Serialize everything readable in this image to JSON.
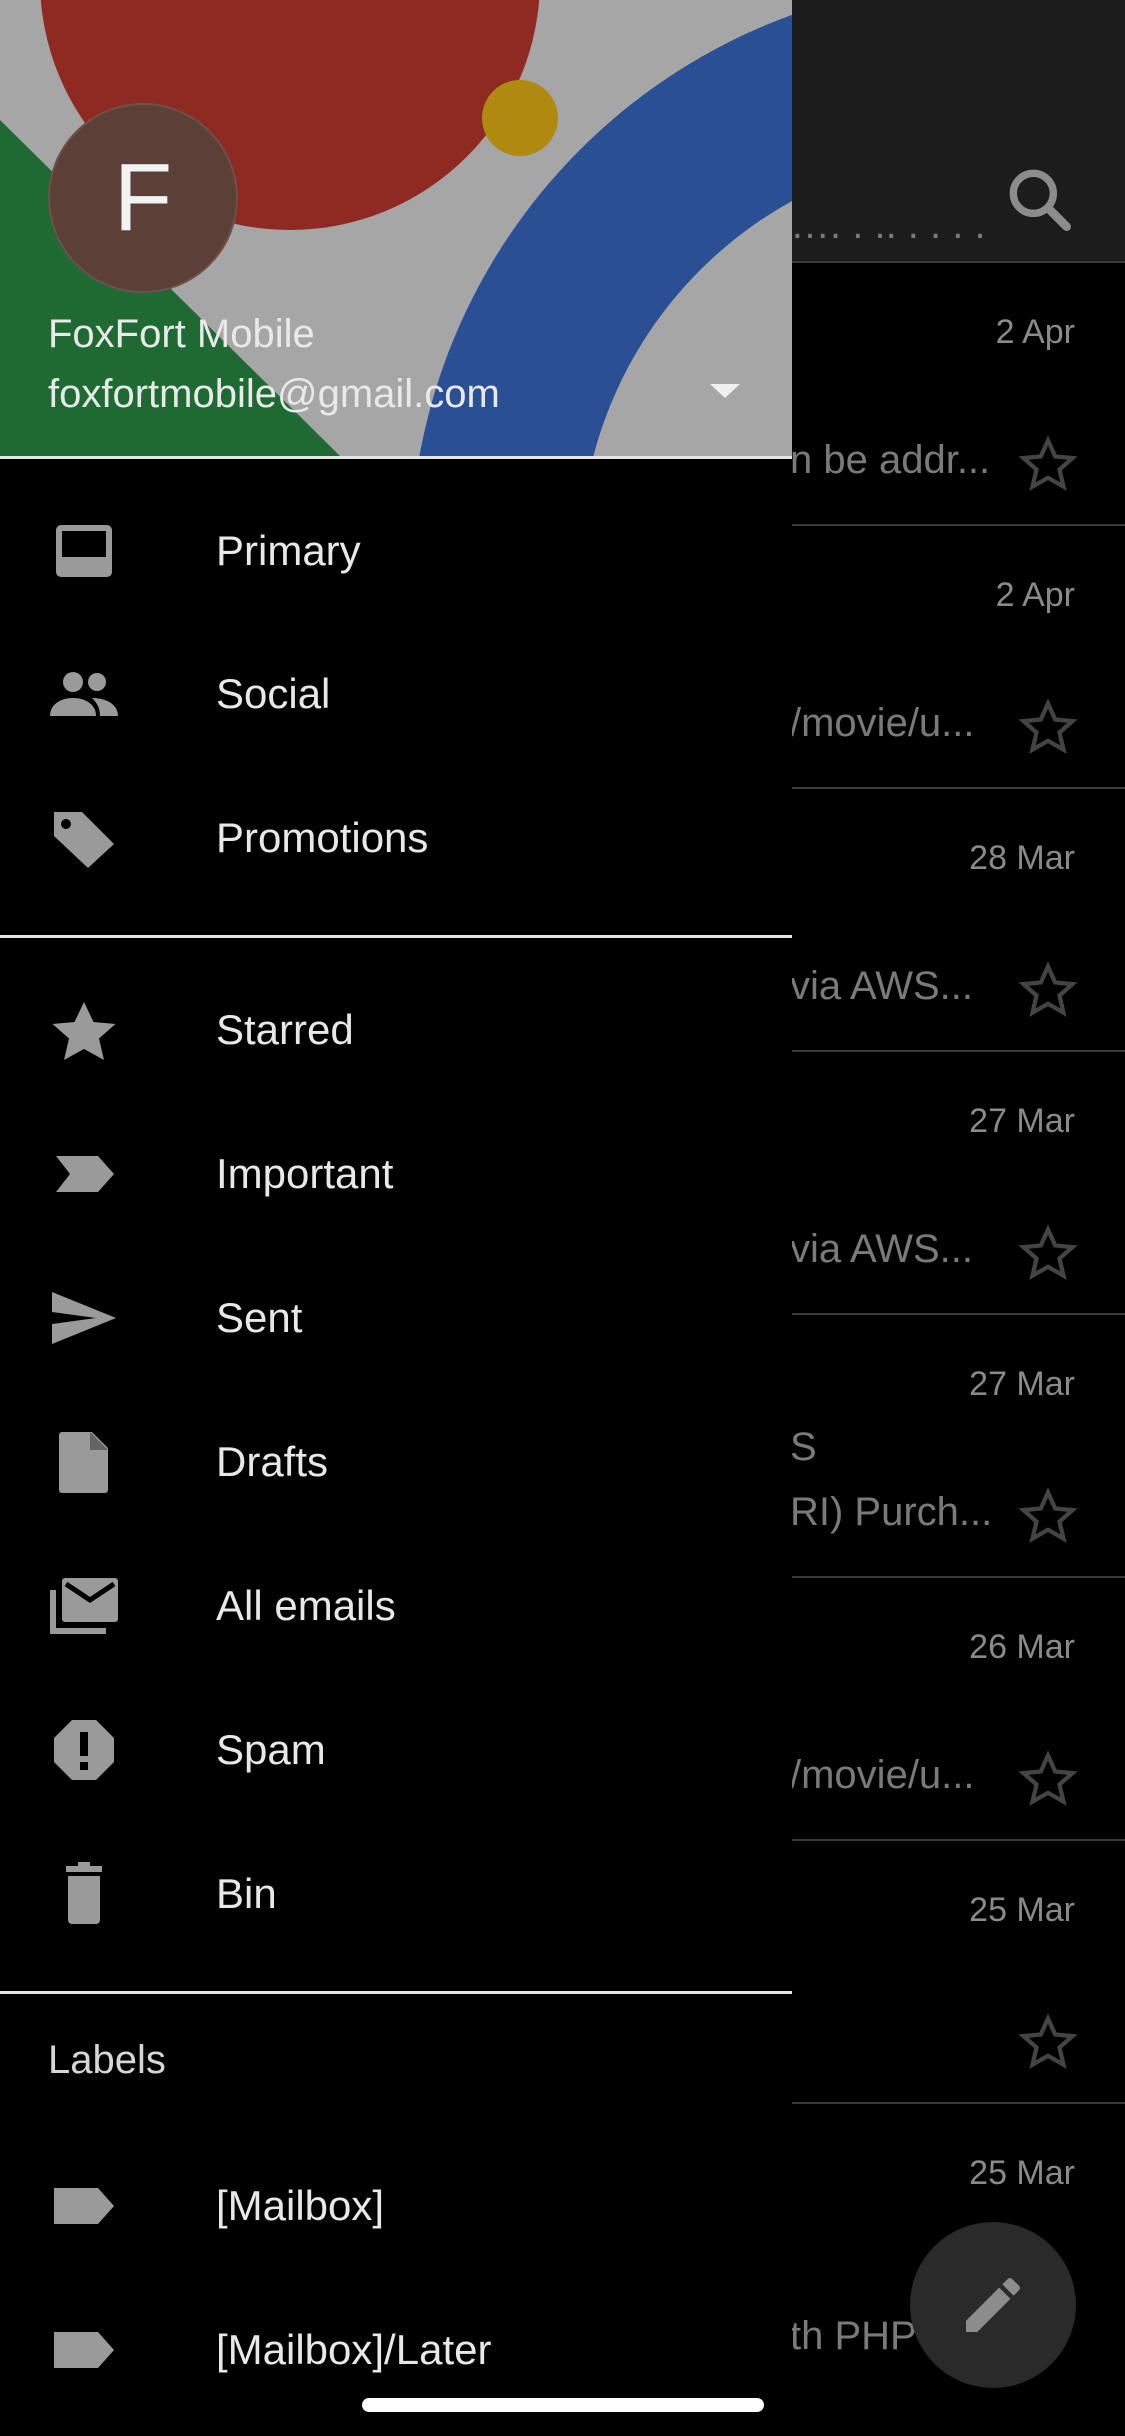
{
  "inbox": {
    "emails": [
      {
        "date": "",
        "line1": "",
        "line2": "…. . .. . . . ."
      },
      {
        "date": "2 Apr",
        "line1": "",
        "line2": "n be addr..."
      },
      {
        "date": "2 Apr",
        "line1": "",
        "line2": "/movie/u..."
      },
      {
        "date": "28 Mar",
        "line1": "",
        "line2": "via AWS..."
      },
      {
        "date": "27 Mar",
        "line1": "",
        "line2": "via AWS..."
      },
      {
        "date": "27 Mar",
        "line1": "S",
        "line2": "RI) Purch..."
      },
      {
        "date": "26 Mar",
        "line1": "",
        "line2": "/movie/u..."
      },
      {
        "date": "25 Mar",
        "line1": "",
        "line2": ""
      },
      {
        "date": "25 Mar",
        "line1": "",
        "line2": "th PHP"
      }
    ]
  },
  "account": {
    "avatar_letter": "F",
    "name": "FoxFort Mobile",
    "email": "foxfortmobile@gmail.com"
  },
  "nav": {
    "primary": "Primary",
    "social": "Social",
    "promotions": "Promotions",
    "starred": "Starred",
    "important": "Important",
    "sent": "Sent",
    "drafts": "Drafts",
    "all_emails": "All emails",
    "spam": "Spam",
    "bin": "Bin"
  },
  "labels": {
    "header": "Labels",
    "items": [
      "[Mailbox]",
      "[Mailbox]/Later"
    ]
  },
  "colors": {
    "drawer_bg": "#000000",
    "header_red": "#8f2a22",
    "header_green": "#1f6a33",
    "header_blue": "#2a4f95",
    "header_yellow": "#b08a10",
    "avatar_bg": "#5c4038",
    "icon": "#9a9a9a",
    "text": "#e8e8e8"
  },
  "icons": {
    "primary": "inbox-icon",
    "social": "people-icon",
    "promotions": "tag-icon",
    "starred": "star-icon",
    "important": "important-icon",
    "sent": "send-icon",
    "drafts": "draft-icon",
    "all_emails": "all-mail-icon",
    "spam": "spam-icon",
    "bin": "trash-icon",
    "label": "label-icon",
    "search": "search-icon",
    "compose": "pencil-icon"
  }
}
